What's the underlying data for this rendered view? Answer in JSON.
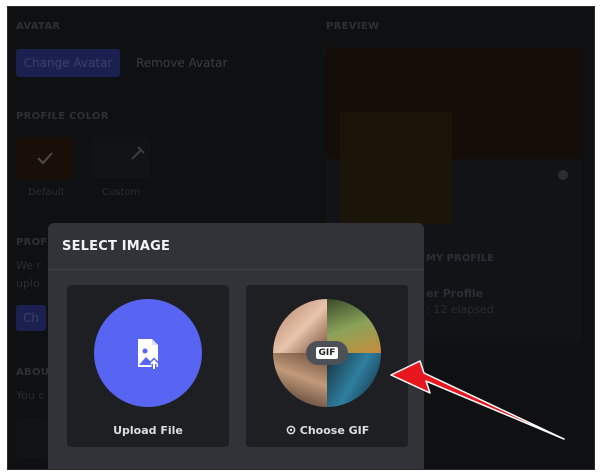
{
  "background": {
    "avatar_section_label": "AVATAR",
    "preview_section_label": "PREVIEW",
    "change_avatar_button": "Change Avatar",
    "remove_avatar_button": "Remove Avatar",
    "profile_color_label": "PROFILE COLOR",
    "default_swatch_label": "Default",
    "custom_swatch_label": "Custom",
    "profile_section_label": "PROFI",
    "profile_text_fragment_1": "We r",
    "profile_text_fragment_2": "uplo",
    "about_label": "ABOU",
    "about_text_fragment": "You c",
    "preview_my_profile": "MY PROFILE",
    "preview_profile_line": "er Profile",
    "preview_elapsed": ": 12 elapsed"
  },
  "modal": {
    "title": "SELECT IMAGE",
    "upload_label": "Upload File",
    "choose_gif_label": "Choose GIF",
    "gif_badge_text": "GIF"
  },
  "colors": {
    "brand": "#5865f2",
    "modal_bg": "#313338",
    "card_bg": "#1e1f22",
    "arrow": "#e8161f"
  },
  "icons": {
    "upload_icon": "image-upload-icon",
    "gif_icon": "gif-sticker-icon",
    "annotation": "red-arrow-annotation"
  }
}
